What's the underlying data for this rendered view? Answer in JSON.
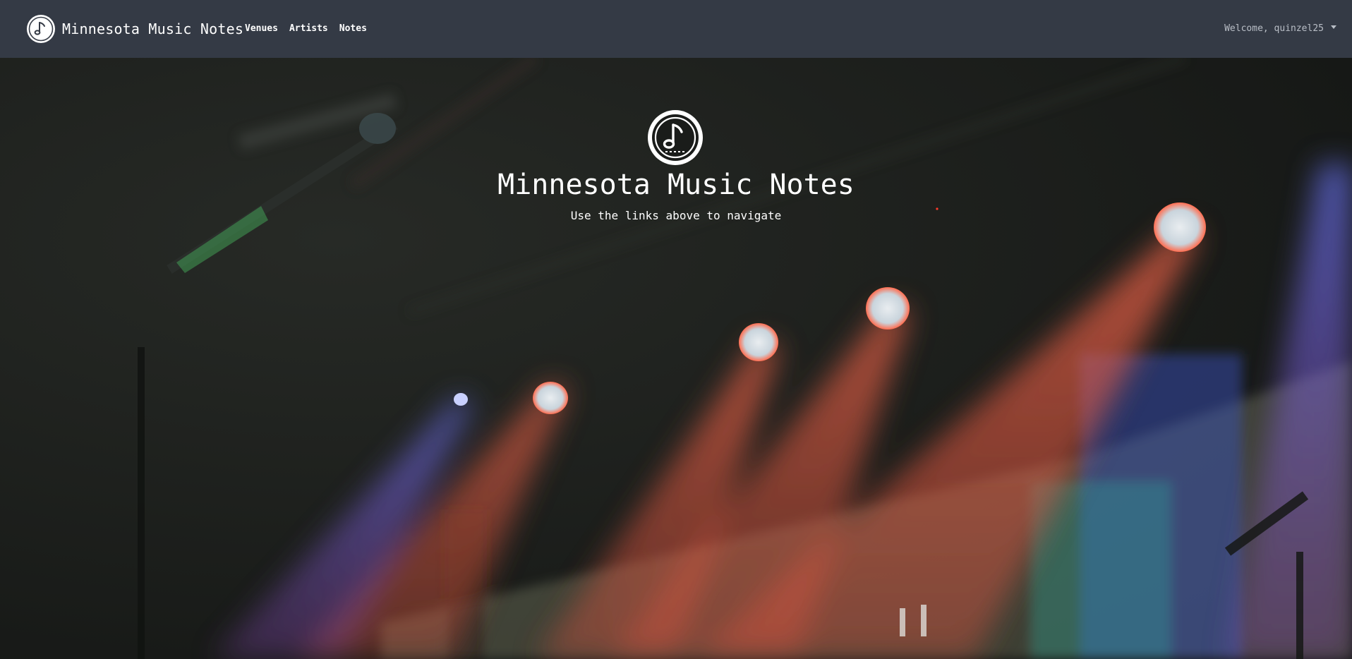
{
  "navbar": {
    "brand": "Minnesota Music Notes",
    "links": [
      {
        "label": "Venues"
      },
      {
        "label": "Artists"
      },
      {
        "label": "Notes"
      }
    ],
    "welcome": "Welcome, quinzel25"
  },
  "hero": {
    "title": "Minnesota Music Notes",
    "subtitle": "Use the links above to navigate"
  },
  "icons": {
    "brand": "music-note-logo-icon",
    "dropdown": "caret-down-icon"
  },
  "colors": {
    "navbar": "#343a45",
    "nav_text": "#ffffff",
    "welcome_text": "#b9bec6",
    "stage_red": "#e2553f",
    "stage_blue": "#5c6cf0"
  }
}
